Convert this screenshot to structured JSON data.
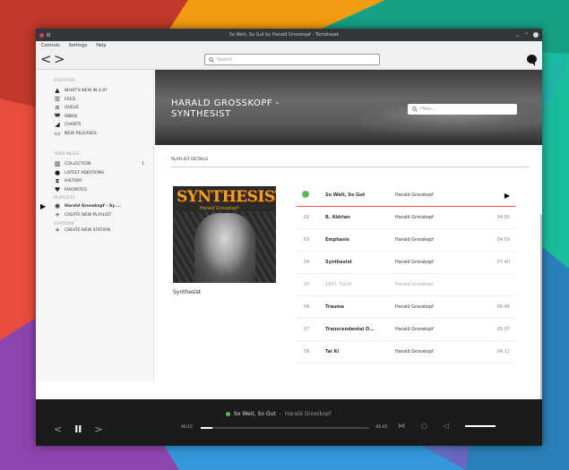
{
  "window": {
    "title": "So Weit, So Gut by Harald Grosskopf - Tomahawk"
  },
  "menu": [
    "Controls",
    "Settings",
    "Help"
  ],
  "toolbar": {
    "back": "<",
    "forward": ">",
    "search_placeholder": "Search"
  },
  "sidebar": {
    "discover_heading": "DISCOVER",
    "discover": [
      {
        "label": "WHAT'S NEW IN 0.8?",
        "icon": "megaphone-icon"
      },
      {
        "label": "FEED",
        "icon": "feed-icon"
      },
      {
        "label": "QUEUE",
        "icon": "queue-icon"
      },
      {
        "label": "INBOX",
        "icon": "inbox-icon"
      },
      {
        "label": "CHARTS",
        "icon": "charts-icon"
      },
      {
        "label": "NEW RELEASES",
        "icon": "new-releases-icon"
      }
    ],
    "yourmusic_heading": "YOUR MUSIC",
    "yourmusic": [
      {
        "label": "COLLECTION",
        "icon": "collection-icon",
        "count": "1"
      },
      {
        "label": "LATEST ADDITIONS",
        "icon": "location-pin-icon"
      },
      {
        "label": "HISTORY",
        "icon": "hourglass-icon"
      },
      {
        "label": "FAVORITES",
        "icon": "heart-icon"
      }
    ],
    "playlists_heading": "PLAYLISTS",
    "playlists": [
      {
        "label": "Harald Grosskopf - Sy ...",
        "icon": "playlist-disc-icon"
      },
      {
        "label": "CREATE NEW PLAYLIST",
        "icon": "plus-icon"
      }
    ],
    "stations_heading": "STATIONS",
    "stations": [
      {
        "label": "CREATE NEW STATION",
        "icon": "plus-icon"
      }
    ]
  },
  "header": {
    "title": "HARALD GROSSKOPF - SYNTHESIST",
    "filter_placeholder": "Filter..."
  },
  "section_label": "PLAYLIST DETAILS",
  "album": {
    "cover_title": "SYNTHESIST",
    "cover_subtitle": "Harald Grosskopf",
    "name": "Synthesist"
  },
  "tracks": [
    {
      "num": "",
      "title": "So Weit, So Gut",
      "artist": "Harald Grosskopf",
      "duration": "",
      "playing": true
    },
    {
      "num": "02",
      "title": "B. Aldrian",
      "artist": "Harald Grosskopf",
      "duration": "04:55"
    },
    {
      "num": "03",
      "title": "Emphasis",
      "artist": "Harald Grosskopf",
      "duration": "04:59"
    },
    {
      "num": "04",
      "title": "Synthesist",
      "artist": "Harald Grosskopf",
      "duration": "07:40"
    },
    {
      "num": "05",
      "title": "1847- Earth",
      "artist": "Harald Grosskopf",
      "duration": "",
      "dim": true
    },
    {
      "num": "06",
      "title": "Trauma",
      "artist": "Harald Grosskopf",
      "duration": "06:46"
    },
    {
      "num": "07",
      "title": "Transcendental O...",
      "artist": "Harald Grosskopf",
      "duration": "05:07"
    },
    {
      "num": "08",
      "title": "Tai Ki",
      "artist": "Harald Grosskopf",
      "duration": "04:11"
    }
  ],
  "player": {
    "prev": "<",
    "pause": "II",
    "next": ">",
    "track": "So Weit, So Gut",
    "separator": "-",
    "artist": "Harald Grosskopf",
    "elapsed": "00:15",
    "remaining": "-05:05",
    "progress": 0.07,
    "colors": {
      "accent_green": "#5cb85c",
      "playing_line": "#e74c3c"
    }
  }
}
